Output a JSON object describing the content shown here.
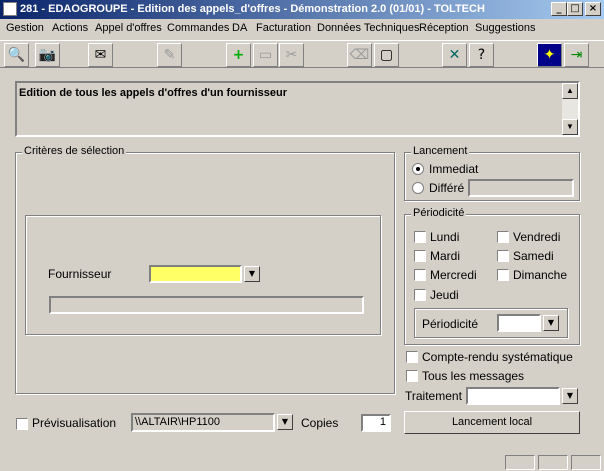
{
  "window": {
    "title": "281 - EDAOGROUPE - Edition des appels_d'offres - Démonstration 2.0 (01/01) - TOLTECH"
  },
  "menu": [
    "Gestion",
    "Actions",
    "Appel d'offres",
    "Commandes",
    "DA",
    "Facturation",
    "Données Techniques",
    "Réception",
    "Suggestions"
  ],
  "description": "Edition de tous les appels d'offres d'un fournisseur",
  "criteria": {
    "legend": "Critères de sélection",
    "supplier_label": "Fournisseur",
    "supplier_value": ""
  },
  "launch": {
    "legend": "Lancement",
    "immediate": "Immediat",
    "deferred": "Différé",
    "selected": "immediate"
  },
  "periodicity": {
    "legend": "Périodicité",
    "days": [
      "Lundi",
      "Mardi",
      "Mercredi",
      "Jeudi",
      "Vendredi",
      "Samedi",
      "Dimanche"
    ],
    "select_label": "Périodicité"
  },
  "options": {
    "report": "Compte-rendu systématique",
    "all_messages": "Tous les messages",
    "processing": "Traitement"
  },
  "bottom": {
    "preview": "Prévisualisation",
    "printer": "\\\\ALTAIR\\HP1100",
    "copies_label": "Copies",
    "copies": "1",
    "local_launch": "Lancement local"
  },
  "colors": {
    "title_start": "#0a246a",
    "title_end": "#a6caf0",
    "supplier_field": "#ffff66"
  }
}
